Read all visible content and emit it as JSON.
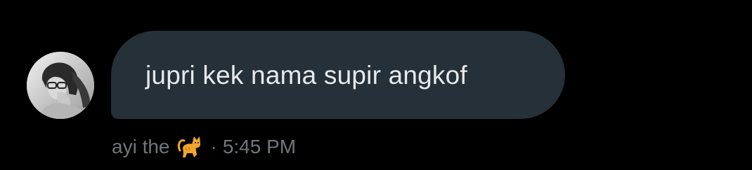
{
  "message": {
    "text": "jupri kek nama supir angkof",
    "bubble_color": "#253038",
    "text_color": "#e7e9ea"
  },
  "sender": {
    "name": "ayi the",
    "emoji_icon": "cat-emoji-icon",
    "separator": "·",
    "time": "5:45 PM",
    "meta_color": "#71767b"
  },
  "avatar": {
    "icon": "user-avatar-photo"
  },
  "background": "#000000"
}
